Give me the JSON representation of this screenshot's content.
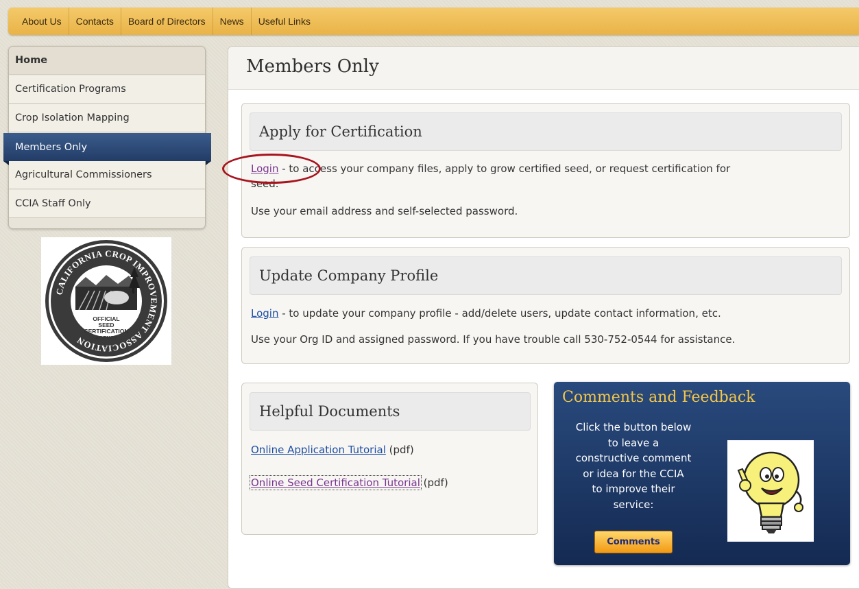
{
  "topnav": {
    "items": [
      "About Us",
      "Contacts",
      "Board of Directors",
      "News",
      "Useful Links"
    ]
  },
  "sidebar": {
    "items": [
      {
        "label": "Home"
      },
      {
        "label": "Certification Programs"
      },
      {
        "label": "Crop Isolation Mapping"
      },
      {
        "label": "Members Only"
      },
      {
        "label": "Agricultural Commissioners"
      },
      {
        "label": "CCIA Staff Only"
      }
    ],
    "active": "Members Only"
  },
  "seal": {
    "ring_text": "CALIFORNIA CROP IMPROVEMENT ASSOCIATION",
    "center_lines": [
      "OFFICIAL",
      "SEED",
      "CERTIFICATION",
      "AGENCY"
    ]
  },
  "main": {
    "title": "Members Only",
    "apply": {
      "heading": "Apply for Certification",
      "link": "Login",
      "line1": " - to access your company files, apply to grow certified seed, or request certification for",
      "line1b": "seed.",
      "line2": "Use your email address and self-selected password."
    },
    "update": {
      "heading": "Update Company Profile",
      "link": "Login",
      "line1": " - to update your company profile - add/delete users, update contact information, etc.",
      "line2": "Use your Org ID and assigned password. If you have trouble call 530-752-0544 for assistance."
    },
    "docs": {
      "heading": "Helpful Documents",
      "items": [
        {
          "link": "Online Application Tutorial",
          "suffix": " (pdf)"
        },
        {
          "link": "Online Seed Certification Tutorial",
          "suffix": " (pdf)"
        }
      ]
    },
    "comments": {
      "title": "Comments and Feedback",
      "lines": [
        "Click the button below",
        "to leave a",
        "constructive comment",
        "or idea for the CCIA",
        "to improve their",
        "service:"
      ],
      "button": "Comments"
    }
  },
  "colors": {
    "nav_bg": "#efbf58",
    "sidebar_active": "#2c4a78",
    "link": "#1f4fa3",
    "visited_link": "#7a3490",
    "comments_title": "#f3c64a",
    "highlight_oval": "#a8141e"
  }
}
